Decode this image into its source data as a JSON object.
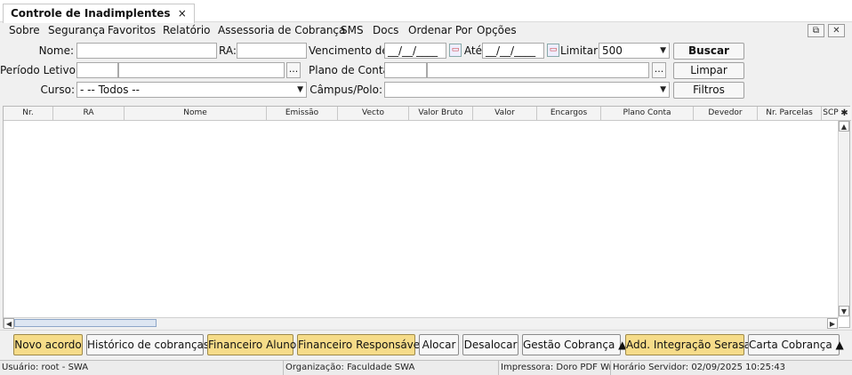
{
  "tab": {
    "title": "Controle de Inadimplentes",
    "close": "×"
  },
  "menu": [
    "Sobre",
    "Segurança",
    "Favoritos",
    "Relatório",
    "Assessoria de Cobrança",
    "SMS",
    "Docs",
    "Ordenar Por",
    "Opções"
  ],
  "window_buttons": {
    "popout": "⧉",
    "close": "✕"
  },
  "filters": {
    "nome_label": "Nome:",
    "ra_label": "RA:",
    "vencimento_label": "Vencimento de:",
    "venc_from": "__/__/____",
    "ate_label": "Até",
    "venc_to": "__/__/____",
    "limitar_label": "Limitar:",
    "limitar_value": "500",
    "periodo_label": "Período Letivo:",
    "plano_label": "Plano de Conta:",
    "curso_label": "Curso:",
    "curso_value": "- -- Todos --",
    "campus_label": "Câmpus/Polo:",
    "dots": "...",
    "buscar": "Buscar",
    "limpar": "Limpar",
    "filtros": "Filtros"
  },
  "table": {
    "columns": [
      "Nr.",
      "RA",
      "Nome",
      "Emissão",
      "Vecto",
      "Valor Bruto",
      "Valor",
      "Encargos",
      "Plano Conta",
      "Devedor",
      "Nr. Parcelas",
      "SCP"
    ]
  },
  "actions": [
    "Novo acordo",
    "Histórico de cobranças",
    "Financeiro Aluno",
    "Financeiro Responsável",
    "Alocar",
    "Desalocar",
    "Gestão Cobrança ▲",
    "Add. Integração Serasa",
    "Carta Cobrança ▲"
  ],
  "status": {
    "usuario": "Usuário: root - SWA",
    "organizacao": "Organização: Faculdade SWA",
    "impressora": "Impressora: Doro PDF Wri...",
    "horario": "Horário Servidor: 02/09/2025 10:25:43"
  }
}
